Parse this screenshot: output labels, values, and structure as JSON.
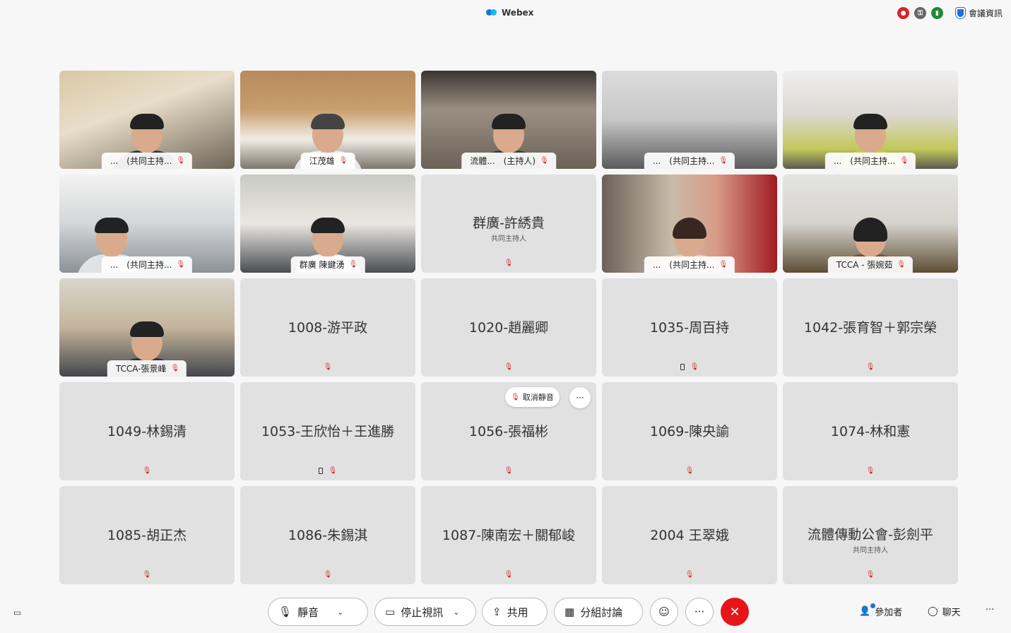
{
  "app": {
    "title": "Webex"
  },
  "topbar": {
    "meeting_info_label": "會議資訊"
  },
  "video_tiles": [
    {
      "label": "...　(共同主持..."
    },
    {
      "label": "江茂雄"
    },
    {
      "label": "流體...　(主持人)"
    },
    {
      "label": "...　(共同主持..."
    },
    {
      "label": "...　(共同主持..."
    },
    {
      "label": "...　(共同主持..."
    },
    {
      "label": "群廣 陳鍵湧"
    },
    {
      "label": "...　(共同主持..."
    },
    {
      "label": "TCCA - 張婉茹"
    },
    {
      "label": "TCCA-張景峰"
    }
  ],
  "name_tiles": [
    {
      "name": "群廣-許綉貴",
      "sub": "共同主持人"
    },
    {
      "name": "1008-游平政"
    },
    {
      "name": "1020-趙麗卿"
    },
    {
      "name": "1035-周百持"
    },
    {
      "name": "1042-張育智＋郭宗榮"
    },
    {
      "name": "1049-林錫清"
    },
    {
      "name": "1053-王欣怡＋王進勝"
    },
    {
      "name": "1056-張福彬"
    },
    {
      "name": "1069-陳央諭"
    },
    {
      "name": "1074-林和憲"
    },
    {
      "name": "1085-胡正杰"
    },
    {
      "name": "1086-朱錫淇"
    },
    {
      "name": "1087-陳南宏＋關郁峻"
    },
    {
      "name": "2004 王翠娥"
    },
    {
      "name": "流體傳動公會-彭劍平",
      "sub": "共同主持人"
    }
  ],
  "hover_actions": {
    "unmute_label": "取消靜音",
    "more_label": "···"
  },
  "controls": {
    "mute_label": "靜音",
    "stop_video_label": "停止視訊",
    "share_label": "共用",
    "breakout_label": "分組討論",
    "more_label": "···",
    "participants_label": "參加者",
    "chat_label": "聊天",
    "overflow_label": "···"
  },
  "colors": {
    "end_call": "#e5151a",
    "accent": "#1e6fe0",
    "muted_mic": "#d4252b"
  }
}
